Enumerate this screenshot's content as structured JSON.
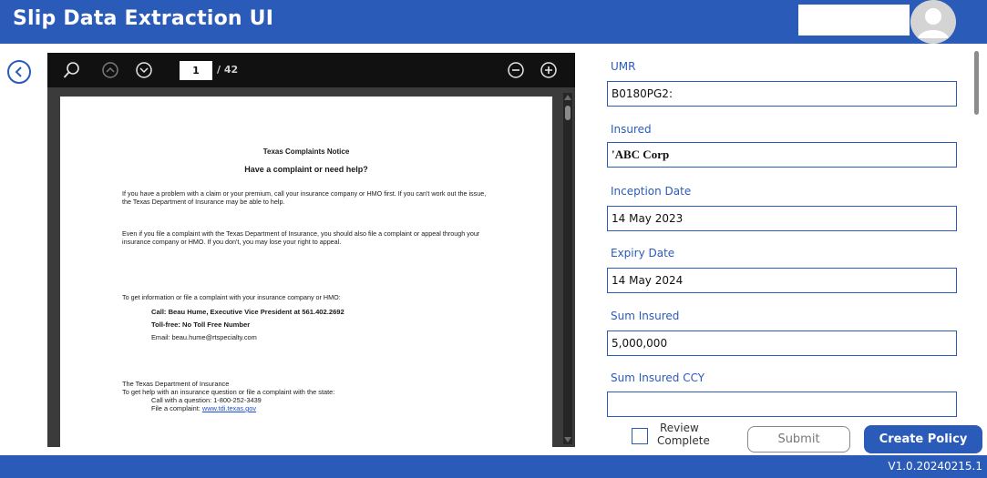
{
  "app": {
    "title": "Slip Data Extraction UI",
    "version": "V1.0.20240215.1"
  },
  "viewer": {
    "current_page": "1",
    "total_pages": "/ 42",
    "document": {
      "title": "Texas Complaints Notice",
      "subtitle": "Have a complaint or need help?",
      "paragraph1": "If you have a problem with a claim or your premium, call your insurance company or HMO first. If you can't work out the issue, the Texas Department of Insurance may be able to help.",
      "paragraph2": "Even if you file a complaint with the Texas Department of Insurance, you should also file a complaint or appeal through your insurance company or HMO. If you don't, you may lose your right to appeal.",
      "paragraph3": "To get information or file a complaint with your insurance company or HMO:",
      "call_line": "Call: Beau Hume, Executive Vice President at 561.402.2692",
      "tollfree_line": "Toll-free: No Toll Free Number",
      "email_line": "Email: beau.hume@rtspecialty.com",
      "tdi_line1": "The Texas Department of Insurance",
      "tdi_line2": "To get help with an insurance question or file a complaint with the state:",
      "tdi_call": "Call with a question: 1-800-252-3439",
      "tdi_file_prefix": "File a complaint:",
      "tdi_link": "www.tdi.texas.gov"
    }
  },
  "form": {
    "fields": [
      {
        "label": "UMR",
        "value": "B0180PG2:"
      },
      {
        "label": "Insured",
        "value": "'ABC Corp"
      },
      {
        "label": "Inception Date",
        "value": "14 May 2023"
      },
      {
        "label": "Expiry Date",
        "value": "14 May 2024"
      },
      {
        "label": "Sum Insured",
        "value": "5,000,000"
      },
      {
        "label": "Sum Insured CCY",
        "value": ""
      }
    ],
    "review_label_line1": "Review",
    "review_label_line2": "Complete",
    "review_checked": false,
    "submit_label": "Submit",
    "create_policy_label": "Create Policy"
  },
  "colors": {
    "brand": "#2b5bb8",
    "viewer_bg": "#3b3b3b",
    "toolbar_bg": "#111111"
  },
  "icons": {
    "back": "chevron-left-circle-icon",
    "search": "search-icon",
    "prev_page": "chevron-up-circle-icon",
    "next_page": "chevron-down-circle-icon",
    "zoom_out": "zoom-out-icon",
    "zoom_in": "zoom-in-icon",
    "avatar": "user-avatar-icon"
  }
}
